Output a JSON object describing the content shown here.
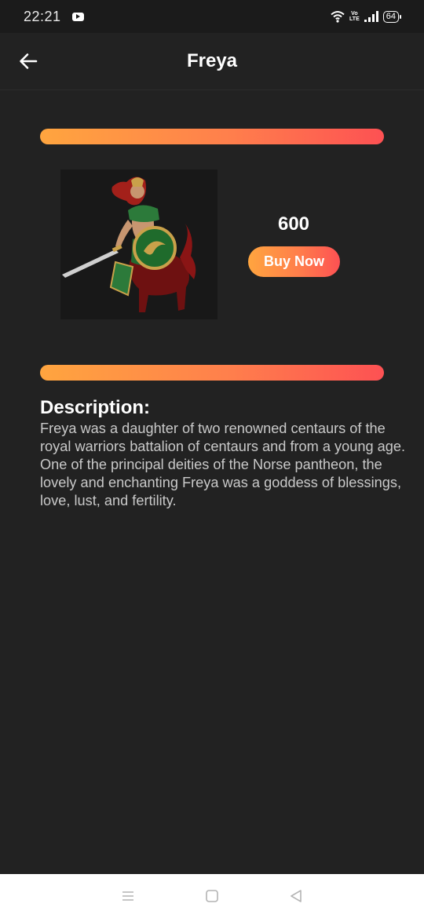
{
  "status_bar": {
    "time": "22:21",
    "volte_top": "Vo",
    "volte_bottom": "LTE",
    "battery": "64",
    "icons": [
      "youtube-icon",
      "wifi-icon",
      "volte-icon",
      "signal-icon",
      "battery-icon"
    ]
  },
  "app_bar": {
    "title": "Freya",
    "back_icon": "arrow-left-icon"
  },
  "product": {
    "image_icon": "centaur-warrior-illustration",
    "price": "600",
    "buy_label": "Buy Now"
  },
  "description": {
    "heading": "Description:",
    "text": "Freya was a daughter of two renowned centaurs of the royal warriors battalion of centaurs and from a young age. One of the principal deities of the Norse pantheon, the lovely and enchanting Freya was a goddess of blessings, love, lust, and fertility."
  },
  "nav_bar": {
    "icons": [
      "menu-icon",
      "home-square-icon",
      "back-triangle-icon"
    ]
  },
  "colors": {
    "background": "#222222",
    "accent_start": "#ffa53f",
    "accent_end": "#fd5153",
    "text_primary": "#ffffff",
    "text_secondary": "#c9c9c9"
  }
}
